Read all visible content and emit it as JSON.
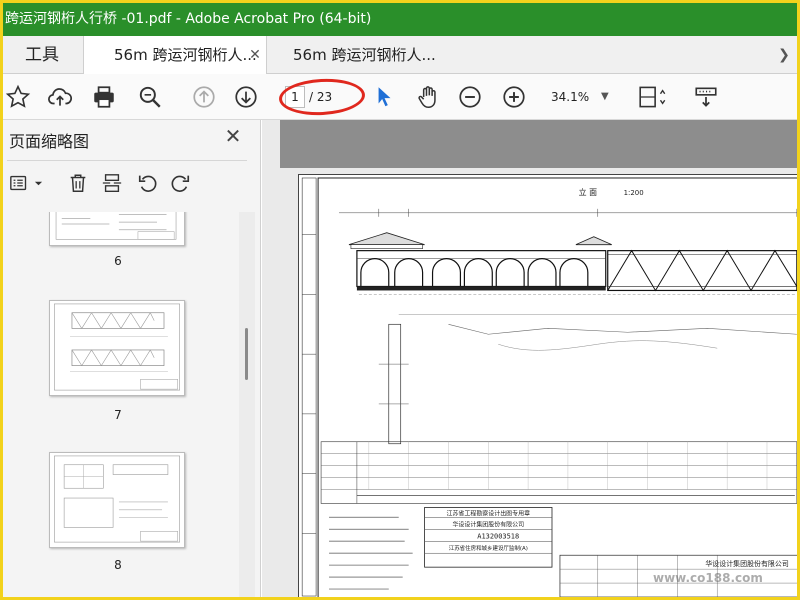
{
  "window": {
    "title": "跨运河钢桁人行桥 -01.pdf - Adobe Acrobat Pro (64-bit)"
  },
  "tabs": {
    "tools_label": "工具",
    "items": [
      {
        "label": "56m 跨运河钢桁人..."
      },
      {
        "label": "56m 跨运河钢桁人..."
      }
    ]
  },
  "toolbar": {
    "page_current": "1",
    "page_total": "/ 23",
    "zoom": "34.1%",
    "icons": [
      "star-icon",
      "cloud-upload-icon",
      "print-icon",
      "zoom-search-icon",
      "page-up-icon",
      "page-down-icon",
      "cursor-select-icon",
      "hand-icon",
      "zoom-out-icon",
      "zoom-in-icon",
      "fit-page-icon",
      "scroll-mode-icon"
    ]
  },
  "sidebar": {
    "title": "页面缩略图",
    "thumbnails": [
      {
        "label": "6"
      },
      {
        "label": "7"
      },
      {
        "label": "8"
      }
    ]
  },
  "document": {
    "drawing_title": "立 面",
    "scale": "1:200",
    "company": "华设设计集团股份有限公司",
    "cert_number": "A132003518",
    "stamp_line1": "江苏省工程勘察设计出图专用章",
    "stamp_line2": "华设设计集团股份有限公司",
    "stamp_org": "江苏省住房和城乡建设厅监制(A)"
  },
  "watermark": "www.co188.com",
  "colors": {
    "titlebar": "#2a8f2a",
    "frame": "#f2d21c",
    "annotation": "#e0281e",
    "cursor": "#1f6fd6"
  }
}
